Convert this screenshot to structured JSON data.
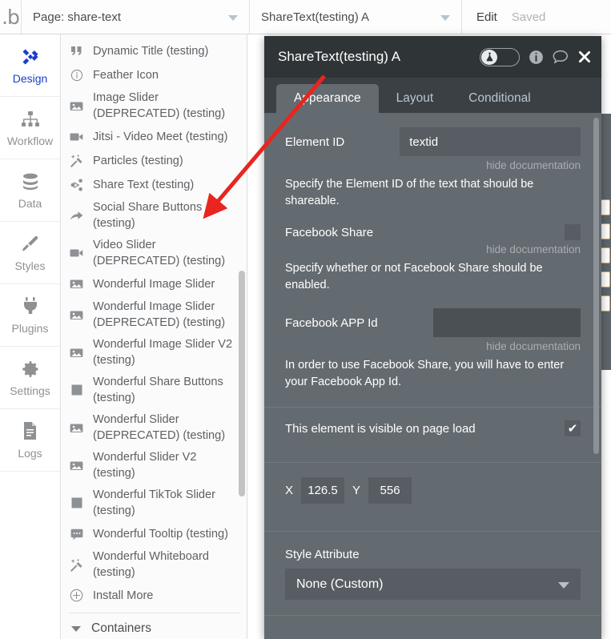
{
  "topbar": {
    "logo": "bubble-logo",
    "page_selector": {
      "value": "Page: share-text",
      "icon": "chevron-down-icon"
    },
    "element_selector": {
      "value": "ShareText(testing) A",
      "icon": "chevron-down-icon"
    },
    "edit_label": "Edit",
    "saved_label": "Saved"
  },
  "rail": {
    "items": [
      {
        "label": "Design",
        "icon": "design-icon",
        "active": true
      },
      {
        "label": "Workflow",
        "icon": "workflow-icon",
        "active": false
      },
      {
        "label": "Data",
        "icon": "data-icon",
        "active": false
      },
      {
        "label": "Styles",
        "icon": "brush-icon",
        "active": false
      },
      {
        "label": "Plugins",
        "icon": "plug-icon",
        "active": false
      },
      {
        "label": "Settings",
        "icon": "gear-icon",
        "active": false
      },
      {
        "label": "Logs",
        "icon": "logs-icon",
        "active": false
      }
    ]
  },
  "palette": {
    "items": [
      {
        "label": "Dynamic Title (testing)",
        "icon": "quote-icon"
      },
      {
        "label": "Feather Icon",
        "icon": "info-circle-icon"
      },
      {
        "label": "Image Slider (DEPRECATED) (testing)",
        "icon": "image-icon"
      },
      {
        "label": "Jitsi - Video Meet (testing)",
        "icon": "video-camera-icon"
      },
      {
        "label": "Particles (testing)",
        "icon": "magic-wand-icon"
      },
      {
        "label": "Share Text (testing)",
        "icon": "share-icon"
      },
      {
        "label": "Social Share Buttons (testing)",
        "icon": "arrow-share-icon"
      },
      {
        "label": "Video Slider (DEPRECATED) (testing)",
        "icon": "video-camera-icon"
      },
      {
        "label": "Wonderful Image Slider",
        "icon": "image-icon"
      },
      {
        "label": "Wonderful Image Slider (DEPRECATED) (testing)",
        "icon": "image-icon"
      },
      {
        "label": "Wonderful Image Slider V2 (testing)",
        "icon": "image-icon"
      },
      {
        "label": "Wonderful Share Buttons (testing)",
        "icon": "square-icon"
      },
      {
        "label": "Wonderful Slider (DEPRECATED) (testing)",
        "icon": "image-icon"
      },
      {
        "label": "Wonderful Slider V2 (testing)",
        "icon": "image-icon"
      },
      {
        "label": "Wonderful TikTok Slider (testing)",
        "icon": "square-icon"
      },
      {
        "label": "Wonderful Tooltip (testing)",
        "icon": "comment-icon"
      },
      {
        "label": "Wonderful Whiteboard (testing)",
        "icon": "magic-wand-icon"
      },
      {
        "label": "Install More",
        "icon": "plus-circle-icon"
      }
    ],
    "group_label": "Containers",
    "collapse_icon": "collapse-left-arrow-icon",
    "scrollbar": "palette-scrollbar"
  },
  "modal": {
    "title": "ShareText(testing) A",
    "header_icons": {
      "ab_toggle": "flask-toggle",
      "info": "info-icon",
      "comment": "comment-icon",
      "close": "close-icon"
    },
    "tabs": [
      {
        "label": "Appearance",
        "active": true
      },
      {
        "label": "Layout",
        "active": false
      },
      {
        "label": "Conditional",
        "active": false
      }
    ],
    "fields": {
      "element_id": {
        "label": "Element ID",
        "value": "textid",
        "hide_doc": "hide documentation",
        "doc": "Specify the Element ID of the text that should be shareable."
      },
      "facebook_share": {
        "label": "Facebook Share",
        "checked": false,
        "hide_doc": "hide documentation",
        "doc": "Specify whether or not Facebook Share should be enabled."
      },
      "facebook_app_id": {
        "label": "Facebook APP Id",
        "value": "",
        "hide_doc": "hide documentation",
        "doc": "In order to use Facebook Share, you will have to enter your Facebook App Id."
      },
      "visible_on_load": {
        "label": "This element is visible on page load",
        "checked": true,
        "check_glyph": "✔"
      },
      "position": {
        "x_label": "X",
        "x_value": "126.5",
        "y_label": "Y",
        "y_value": "556"
      },
      "style_attribute": {
        "label": "Style Attribute",
        "value": "None (Custom)",
        "caret": "chevron-down-icon"
      }
    }
  },
  "annotation": {
    "type": "arrow",
    "color": "#e8251f",
    "points": "from ShareText(testing) A title to Share Text (testing) palette item"
  }
}
